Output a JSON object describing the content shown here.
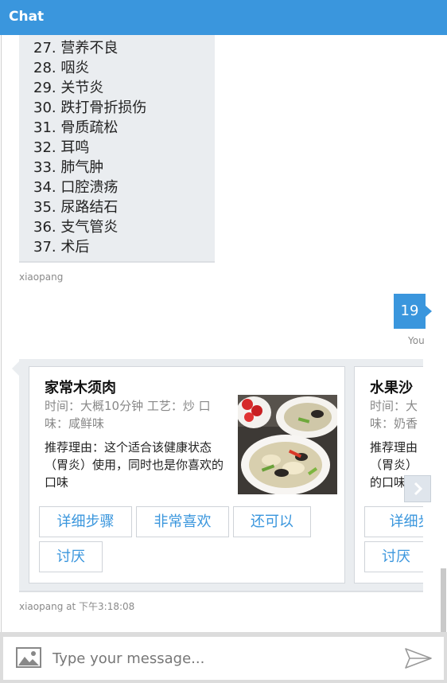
{
  "header": {
    "title": "Chat"
  },
  "messages": {
    "diseases": [
      "27. 营养不良",
      "28. 咽炎",
      "29. 关节炎",
      "30. 跌打骨折损伤",
      "31. 骨质疏松",
      "32. 耳鸣",
      "33. 肺气肿",
      "34. 口腔溃疡",
      "35. 尿路结石",
      "36. 支气管炎",
      "37. 术后"
    ],
    "bot_sender": "xiaopang",
    "user_text": "19",
    "user_sender": "You",
    "cards_sender": "xiaopang at 下午3:18:08"
  },
  "cards": [
    {
      "title": "家常木须肉",
      "meta": "时间：大概10分钟 工艺：炒 口味：咸鲜味",
      "reason": "推荐理由：这个适合该健康状态（胃炎）使用，同时也是你喜欢的口味",
      "buttons": [
        "详细步骤",
        "非常喜欢",
        "还可以",
        "讨厌"
      ]
    },
    {
      "title": "水果沙",
      "meta": "时间：大",
      "meta2": "味：奶香",
      "reason": "推荐理由",
      "reason2": "（胃炎）",
      "reason3": "的口味",
      "buttons": [
        "详细步",
        "讨厌"
      ]
    }
  ],
  "input": {
    "placeholder": "Type your message..."
  },
  "colors": {
    "accent": "#3a96dd",
    "bubble": "#eaedf0"
  }
}
